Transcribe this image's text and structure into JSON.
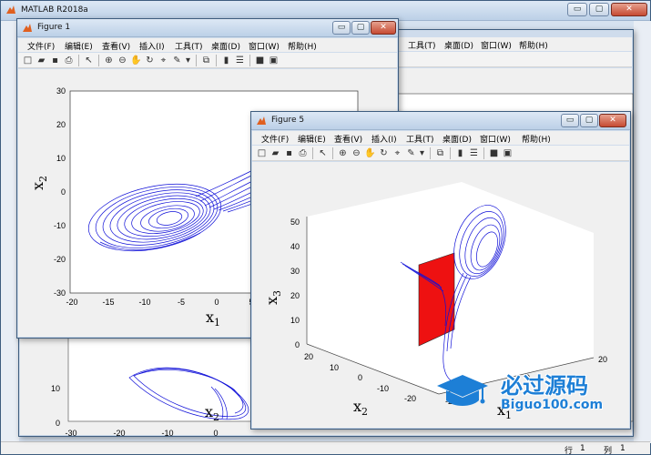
{
  "app": {
    "title": "MATLAB R2018a",
    "window_controls": {
      "minimize": "▭",
      "maximize": "▢",
      "close": "✕"
    }
  },
  "menu": [
    "文件(F)",
    "编辑(E)",
    "查看(V)",
    "插入(I)",
    "工具(T)",
    "桌面(D)",
    "窗口(W)",
    "帮助(H)"
  ],
  "figure1": {
    "title": "Figure 1",
    "plot": {
      "x_ticks": [
        "-20",
        "-15",
        "-10",
        "-5",
        "0",
        "5"
      ],
      "y_ticks": [
        "30",
        "20",
        "10",
        "0",
        "-10",
        "-20",
        "-30"
      ],
      "xlabel_main": "x",
      "xlabel_sub": "1",
      "ylabel_main": "x",
      "ylabel_sub": "2"
    }
  },
  "figure_behind": {
    "plot": {
      "y_ticks": [
        "10",
        "0"
      ],
      "x_ticks": [
        "-30",
        "-20",
        "-10",
        "0"
      ],
      "xlabel_main": "x",
      "xlabel_sub": "2"
    }
  },
  "figure5": {
    "title": "Figure 5",
    "plot": {
      "z_ticks": [
        "50",
        "40",
        "30",
        "20",
        "10",
        "0"
      ],
      "y_ticks": [
        "20",
        "10",
        "0",
        "-10",
        "-20"
      ],
      "x_ticks": [
        "20",
        "0",
        "-20"
      ],
      "zlabel_main": "x",
      "zlabel_sub": "3",
      "ylabel_main": "x",
      "ylabel_sub": "2",
      "xlabel_main": "x",
      "xlabel_sub": "1"
    }
  },
  "statusbar": {
    "row_label": "行",
    "row_value": "1",
    "col_label": "列",
    "col_value": "1"
  },
  "watermark": {
    "cn": "必过源码",
    "url": "Biguo100.com"
  },
  "colors": {
    "trajectory": "#1010d8",
    "plane": "#ee1111",
    "watermark": "#1d7fd6"
  }
}
